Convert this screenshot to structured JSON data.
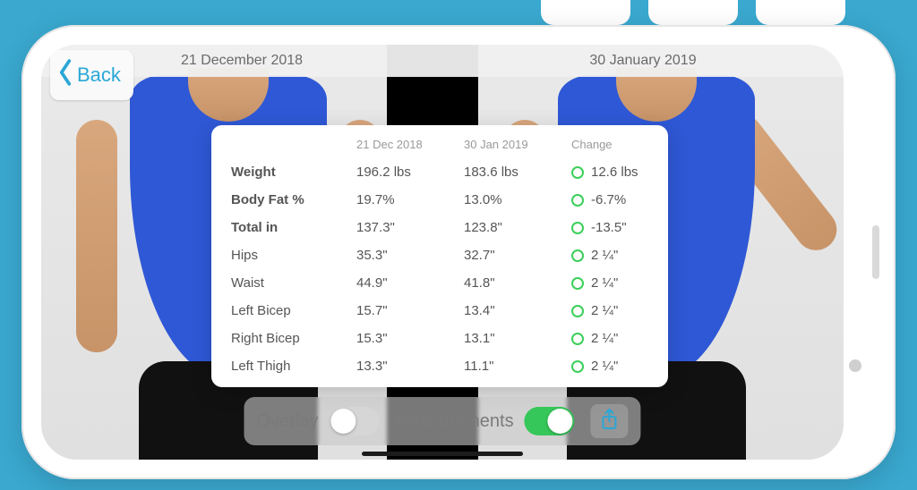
{
  "nav": {
    "back_label": "Back"
  },
  "dates": {
    "left": "21 December 2018",
    "right": "30 January 2019"
  },
  "panel": {
    "headers": {
      "label": "",
      "col_a": "21 Dec 2018",
      "col_b": "30 Jan 2019",
      "change": "Change"
    },
    "rows": [
      {
        "label": "Weight",
        "bold": true,
        "a": "196.2 lbs",
        "b": "183.6 lbs",
        "change": "12.6 lbs"
      },
      {
        "label": "Body Fat %",
        "bold": true,
        "a": "19.7%",
        "b": "13.0%",
        "change": "-6.7%"
      },
      {
        "label": "Total in",
        "bold": true,
        "a": "137.3\"",
        "b": "123.8\"",
        "change": "-13.5\""
      },
      {
        "label": "Hips",
        "bold": false,
        "a": "35.3\"",
        "b": "32.7\"",
        "change": "2 ¼\""
      },
      {
        "label": "Waist",
        "bold": false,
        "a": "44.9\"",
        "b": "41.8\"",
        "change": "2 ¼\""
      },
      {
        "label": "Left Bicep",
        "bold": false,
        "a": "15.7\"",
        "b": "13.4\"",
        "change": "2 ¼\""
      },
      {
        "label": "Right Bicep",
        "bold": false,
        "a": "15.3\"",
        "b": "13.1\"",
        "change": "2 ¼\""
      },
      {
        "label": "Left Thigh",
        "bold": false,
        "a": "13.3\"",
        "b": "11.1\"",
        "change": "2 ¼\""
      }
    ]
  },
  "controls": {
    "overlay_label": "Overlay",
    "overlay_on": false,
    "measurements_label": "Measurements",
    "measurements_on": true
  },
  "colors": {
    "accent": "#2aa7d6",
    "positive": "#3bcf5a",
    "toggle_on": "#35c759"
  }
}
